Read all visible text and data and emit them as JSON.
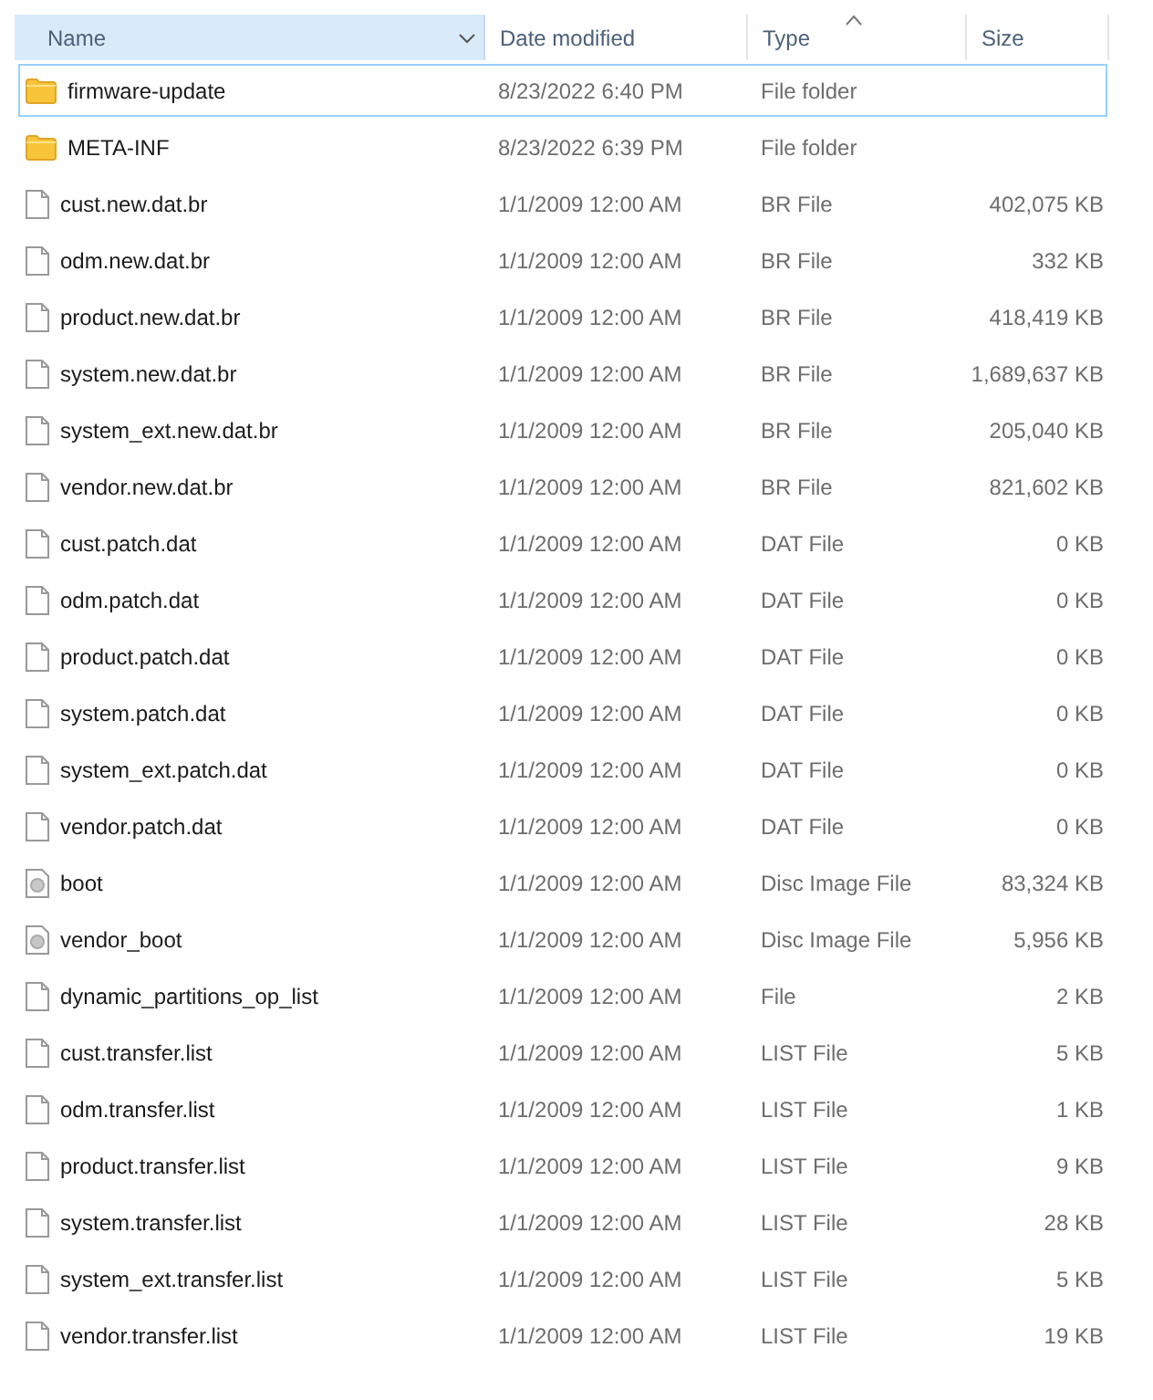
{
  "columns": [
    {
      "label": "Name",
      "highlighted": true,
      "dropdown": true,
      "sorted": false
    },
    {
      "label": "Date modified",
      "highlighted": false,
      "dropdown": false,
      "sorted": false
    },
    {
      "label": "Type",
      "highlighted": false,
      "dropdown": false,
      "sorted": true
    },
    {
      "label": "Size",
      "highlighted": false,
      "dropdown": false,
      "sorted": false
    }
  ],
  "rows": [
    {
      "kind": "folder",
      "name": "firmware-update",
      "date": "8/23/2022 6:40 PM",
      "type": "File folder",
      "size": "",
      "focused": true
    },
    {
      "kind": "folder",
      "name": "META-INF",
      "date": "8/23/2022 6:39 PM",
      "type": "File folder",
      "size": "",
      "focused": false
    },
    {
      "kind": "file",
      "name": "cust.new.dat.br",
      "date": "1/1/2009 12:00 AM",
      "type": "BR File",
      "size": "402,075 KB",
      "focused": false
    },
    {
      "kind": "file",
      "name": "odm.new.dat.br",
      "date": "1/1/2009 12:00 AM",
      "type": "BR File",
      "size": "332 KB",
      "focused": false
    },
    {
      "kind": "file",
      "name": "product.new.dat.br",
      "date": "1/1/2009 12:00 AM",
      "type": "BR File",
      "size": "418,419 KB",
      "focused": false
    },
    {
      "kind": "file",
      "name": "system.new.dat.br",
      "date": "1/1/2009 12:00 AM",
      "type": "BR File",
      "size": "1,689,637 KB",
      "focused": false
    },
    {
      "kind": "file",
      "name": "system_ext.new.dat.br",
      "date": "1/1/2009 12:00 AM",
      "type": "BR File",
      "size": "205,040 KB",
      "focused": false
    },
    {
      "kind": "file",
      "name": "vendor.new.dat.br",
      "date": "1/1/2009 12:00 AM",
      "type": "BR File",
      "size": "821,602 KB",
      "focused": false
    },
    {
      "kind": "file",
      "name": "cust.patch.dat",
      "date": "1/1/2009 12:00 AM",
      "type": "DAT File",
      "size": "0 KB",
      "focused": false
    },
    {
      "kind": "file",
      "name": "odm.patch.dat",
      "date": "1/1/2009 12:00 AM",
      "type": "DAT File",
      "size": "0 KB",
      "focused": false
    },
    {
      "kind": "file",
      "name": "product.patch.dat",
      "date": "1/1/2009 12:00 AM",
      "type": "DAT File",
      "size": "0 KB",
      "focused": false
    },
    {
      "kind": "file",
      "name": "system.patch.dat",
      "date": "1/1/2009 12:00 AM",
      "type": "DAT File",
      "size": "0 KB",
      "focused": false
    },
    {
      "kind": "file",
      "name": "system_ext.patch.dat",
      "date": "1/1/2009 12:00 AM",
      "type": "DAT File",
      "size": "0 KB",
      "focused": false
    },
    {
      "kind": "file",
      "name": "vendor.patch.dat",
      "date": "1/1/2009 12:00 AM",
      "type": "DAT File",
      "size": "0 KB",
      "focused": false
    },
    {
      "kind": "disc",
      "name": "boot",
      "date": "1/1/2009 12:00 AM",
      "type": "Disc Image File",
      "size": "83,324 KB",
      "focused": false
    },
    {
      "kind": "disc",
      "name": "vendor_boot",
      "date": "1/1/2009 12:00 AM",
      "type": "Disc Image File",
      "size": "5,956 KB",
      "focused": false
    },
    {
      "kind": "file",
      "name": "dynamic_partitions_op_list",
      "date": "1/1/2009 12:00 AM",
      "type": "File",
      "size": "2 KB",
      "focused": false
    },
    {
      "kind": "file",
      "name": "cust.transfer.list",
      "date": "1/1/2009 12:00 AM",
      "type": "LIST File",
      "size": "5 KB",
      "focused": false
    },
    {
      "kind": "file",
      "name": "odm.transfer.list",
      "date": "1/1/2009 12:00 AM",
      "type": "LIST File",
      "size": "1 KB",
      "focused": false
    },
    {
      "kind": "file",
      "name": "product.transfer.list",
      "date": "1/1/2009 12:00 AM",
      "type": "LIST File",
      "size": "9 KB",
      "focused": false
    },
    {
      "kind": "file",
      "name": "system.transfer.list",
      "date": "1/1/2009 12:00 AM",
      "type": "LIST File",
      "size": "28 KB",
      "focused": false
    },
    {
      "kind": "file",
      "name": "system_ext.transfer.list",
      "date": "1/1/2009 12:00 AM",
      "type": "LIST File",
      "size": "5 KB",
      "focused": false
    },
    {
      "kind": "file",
      "name": "vendor.transfer.list",
      "date": "1/1/2009 12:00 AM",
      "type": "LIST File",
      "size": "19 KB",
      "focused": false
    }
  ]
}
